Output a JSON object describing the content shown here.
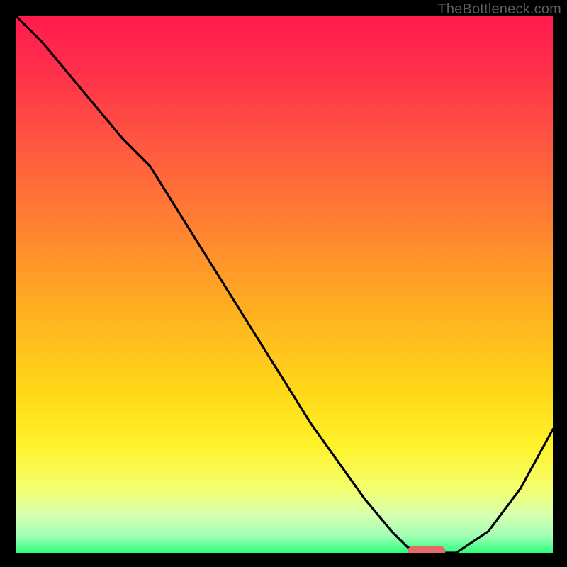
{
  "watermark": "TheBottleneck.com",
  "colors": {
    "curve": "#000000",
    "marker": "#e76a6b"
  },
  "gradient_stops": [
    {
      "offset": 0.0,
      "color": "#ff1a4d"
    },
    {
      "offset": 0.1,
      "color": "#ff2f4b"
    },
    {
      "offset": 0.25,
      "color": "#ff5a3f"
    },
    {
      "offset": 0.4,
      "color": "#ff8430"
    },
    {
      "offset": 0.55,
      "color": "#ffb020"
    },
    {
      "offset": 0.7,
      "color": "#ffd818"
    },
    {
      "offset": 0.8,
      "color": "#fff22a"
    },
    {
      "offset": 0.88,
      "color": "#f4ff6e"
    },
    {
      "offset": 0.93,
      "color": "#d6ffb0"
    },
    {
      "offset": 0.97,
      "color": "#9effb5"
    },
    {
      "offset": 1.0,
      "color": "#2bff7a"
    }
  ],
  "chart_data": {
    "type": "line",
    "title": "",
    "xlabel": "",
    "ylabel": "",
    "xlim": [
      0,
      100
    ],
    "ylim": [
      0,
      100
    ],
    "x": [
      0,
      5,
      10,
      15,
      20,
      25,
      30,
      35,
      40,
      45,
      50,
      55,
      60,
      65,
      70,
      73,
      77,
      82,
      88,
      94,
      100
    ],
    "y": [
      100,
      95,
      89,
      83,
      77,
      72,
      64,
      56,
      48,
      40,
      32,
      24,
      17,
      10,
      4,
      1,
      0,
      0,
      4,
      12,
      23
    ],
    "series": [
      {
        "name": "bottleneck-curve",
        "x_key": "x",
        "y_key": "y"
      }
    ],
    "marker": {
      "x_start": 73,
      "x_end": 80,
      "y": 0
    }
  }
}
